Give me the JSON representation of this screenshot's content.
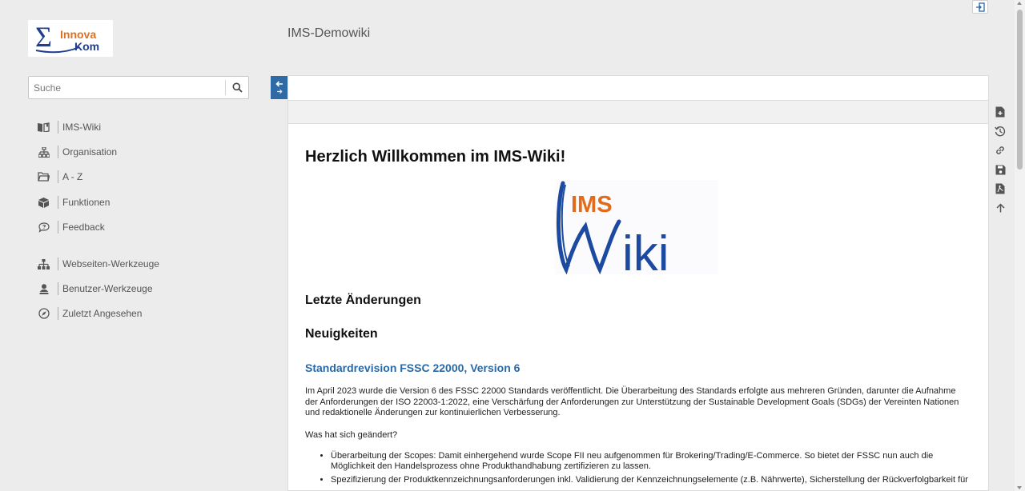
{
  "header": {
    "logo_text_1": "Innova",
    "logo_text_2": "Kom",
    "site_title": "IMS-Demowiki"
  },
  "search": {
    "placeholder": "Suche"
  },
  "nav": {
    "items": [
      {
        "label": "IMS-Wiki",
        "icon": "book-icon"
      },
      {
        "label": "Organisation",
        "icon": "org-chart-icon"
      },
      {
        "label": "A - Z",
        "icon": "folder-icon"
      },
      {
        "label": "Funktionen",
        "icon": "cube-icon"
      },
      {
        "label": "Feedback",
        "icon": "feedback-icon"
      },
      {
        "label": "Webseiten-Werkzeuge",
        "icon": "sitemap-icon"
      },
      {
        "label": "Benutzer-Werkzeuge",
        "icon": "user-icon"
      },
      {
        "label": "Zuletzt Angesehen",
        "icon": "compass-icon"
      }
    ]
  },
  "content": {
    "heading": "Herzlich Willkommen im IMS-Wiki!",
    "wiki_logo_top": "IMS",
    "wiki_logo_bottom": "iki",
    "section_changes": "Letzte Änderungen",
    "section_news": "Neuigkeiten",
    "news_title": "Standardrevision FSSC 22000, Version 6",
    "news_para": "Im April 2023 wurde die Version 6 des FSSC 22000 Standards veröffentlicht. Die Überarbeitung des Standards erfolgte aus mehreren Gründen, darunter die Aufnahme der Anforderungen der ISO 22003-1:2022, eine Verschärfung der Anforderungen zur Unterstützung der Sustainable Development Goals (SDGs) der Vereinten Nationen und redaktionelle Änderungen zur kontinuierlichen Verbesserung.",
    "question": "Was hat sich geändert?",
    "bullets": [
      "Überarbeitung der Scopes: Damit einhergehend wurde Scope FII neu aufgenommen für Brokering/Trading/E-Commerce. So bietet der FSSC nun auch die Möglichkeit den Handelsprozess ohne Produkthandhabung zertifizieren zu lassen.",
      "Spezifizierung der Produktkennzeichnungsanforderungen inkl. Validierung der Kennzeichnungselemente (z.B. Nährwerte), Sicherstellung der Rückverfolgbarkeit für"
    ]
  },
  "colors": {
    "accent": "#2e6aa6",
    "link": "#2869a8",
    "logo_blue": "#1f3e8f",
    "logo_orange": "#e07020",
    "wiki_blue": "#1b4aa0",
    "wiki_orange": "#e26a1c"
  }
}
